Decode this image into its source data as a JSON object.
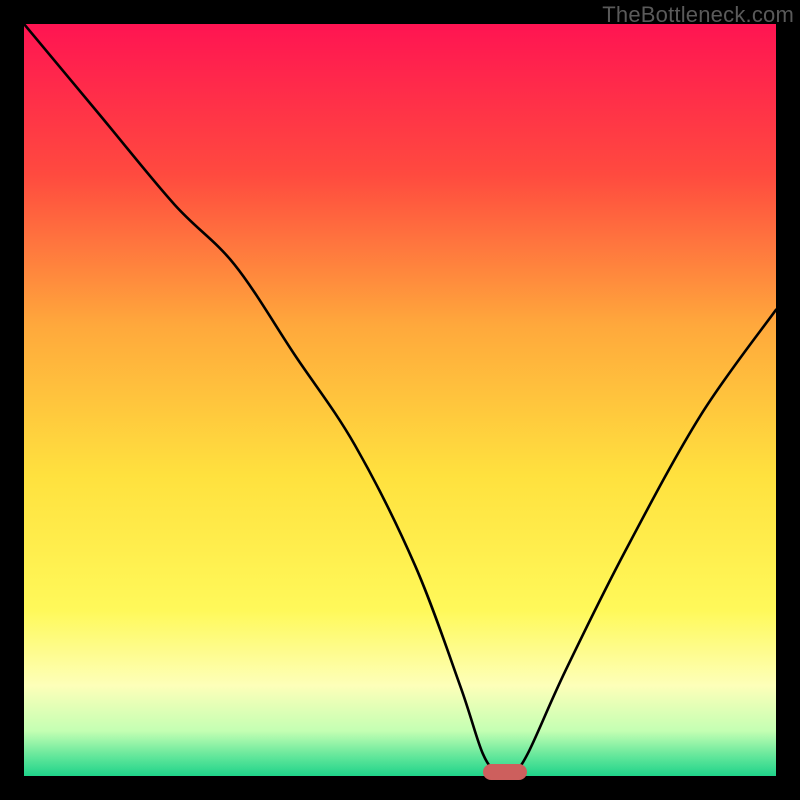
{
  "watermark": "TheBottleneck.com",
  "chart_data": {
    "type": "line",
    "title": "",
    "xlabel": "",
    "ylabel": "",
    "xlim": [
      0,
      100
    ],
    "ylim": [
      0,
      100
    ],
    "grid": false,
    "legend": false,
    "background": {
      "type": "vertical-gradient",
      "stops": [
        {
          "pos": 0.0,
          "color": "#ff1452"
        },
        {
          "pos": 0.2,
          "color": "#ff4a3f"
        },
        {
          "pos": 0.4,
          "color": "#ffa83c"
        },
        {
          "pos": 0.6,
          "color": "#ffe13e"
        },
        {
          "pos": 0.78,
          "color": "#fff95a"
        },
        {
          "pos": 0.88,
          "color": "#fdffb9"
        },
        {
          "pos": 0.94,
          "color": "#c4ffb3"
        },
        {
          "pos": 0.975,
          "color": "#5fe69a"
        },
        {
          "pos": 1.0,
          "color": "#1fd38a"
        }
      ]
    },
    "series": [
      {
        "name": "bottleneck-curve",
        "color": "#000000",
        "x": [
          0,
          10,
          20,
          28,
          36,
          44,
          52,
          58,
          61,
          63,
          65,
          67,
          72,
          80,
          90,
          100
        ],
        "values": [
          100,
          88,
          76,
          68,
          56,
          44,
          28,
          12,
          3,
          0.5,
          0.5,
          3,
          14,
          30,
          48,
          62
        ]
      }
    ],
    "marker": {
      "name": "optimal-point",
      "x": 64,
      "y": 0.5,
      "color": "#cd5f5d"
    }
  }
}
